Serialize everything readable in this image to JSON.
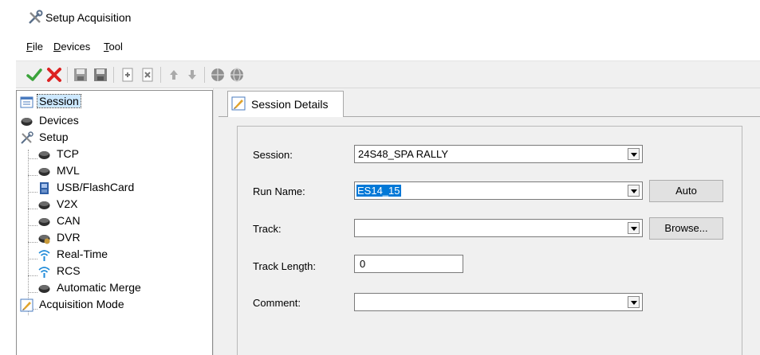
{
  "window": {
    "title": "Setup Acquisition",
    "title_icon": "tools-icon"
  },
  "menu": [
    {
      "label": "File",
      "accel": "F",
      "rest": "ile"
    },
    {
      "label": "Devices",
      "accel": "D",
      "rest": "evices"
    },
    {
      "label": "Tool",
      "accel": "T",
      "rest": "ool"
    }
  ],
  "toolbar": {
    "buttons": [
      "check-icon",
      "x-icon",
      "save-icon",
      "save-as-icon",
      "add-icon",
      "remove-icon",
      "up-arrow-icon",
      "down-arrow-icon",
      "globe-icon",
      "globe-alt-icon"
    ]
  },
  "tree": {
    "session": "Session",
    "devices": "Devices",
    "setup": "Setup",
    "tcp": "TCP",
    "mvl": "MVL",
    "usb": "USB/FlashCard",
    "v2x": "V2X",
    "can": "CAN",
    "dvr": "DVR",
    "realtime": "Real-Time",
    "rcs": "RCS",
    "automerge": "Automatic Merge",
    "acqmode": "Acquisition Mode"
  },
  "tab": {
    "label": "Session Details"
  },
  "form": {
    "session_label": "Session:",
    "session_value": "24S48_SPA RALLY",
    "runname_label": "Run Name:",
    "runname_value": "ES14_15",
    "track_label": "Track:",
    "track_value": "",
    "tracklen_label": "Track Length:",
    "tracklen_value": "0",
    "comment_label": "Comment:",
    "comment_value": "",
    "auto_button": "Auto",
    "browse_button": "Browse..."
  },
  "colors": {
    "selection": "#0078d7",
    "tree_selection": "#cce8ff",
    "panel_bg": "#f0f0f0"
  }
}
